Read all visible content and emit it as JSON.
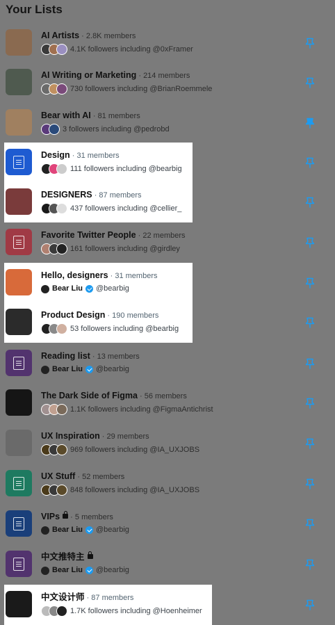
{
  "header": {
    "title": "Your Lists"
  },
  "lists": [
    {
      "name": "AI Artists",
      "members": "2.8K members",
      "sub": "4.1K followers including @0xFramer",
      "pinned": false,
      "highlight": false,
      "thumb": "#8a6a50",
      "avatars": [
        "#3a3a3a",
        "#a07050",
        "#9a8fc0"
      ]
    },
    {
      "name": "AI Writing or Marketing",
      "members": "214 members",
      "sub": "730 followers including @BrianRoemmele",
      "pinned": false,
      "highlight": false,
      "thumb": "#4f5a4f",
      "avatars": [
        "#6a6a6a",
        "#c09060",
        "#7a4a7a"
      ]
    },
    {
      "name": "Bear with AI",
      "members": "81 members",
      "sub": "3 followers including @pedrobd",
      "pinned": true,
      "highlight": false,
      "thumb": "#a08060",
      "avatars": [
        "#5a3a7a",
        "#2a4a7a"
      ]
    },
    {
      "name": "Design",
      "members": "31 members",
      "sub": "111 followers including @bearbig",
      "pinned": false,
      "highlight": true,
      "thumb": "#1e5bd1",
      "avatars": [
        "#222222",
        "#e0457b",
        "#cccccc"
      ]
    },
    {
      "name": "DESIGNERS",
      "members": "87 members",
      "sub": "437 followers including @cellier_",
      "pinned": false,
      "highlight": true,
      "thumb": "#7a3b3b",
      "avatars": [
        "#1a1a1a",
        "#555555",
        "#dddddd"
      ]
    },
    {
      "name": "Favorite Twitter People",
      "members": "22 members",
      "sub": "161 followers including @girdley",
      "pinned": false,
      "highlight": false,
      "thumb": "#a03a45",
      "avatars": [
        "#b08070",
        "#3a3a3a",
        "#222222"
      ]
    },
    {
      "name": "Hello, designers",
      "members": "31 members",
      "sub": "@bearbig",
      "owner": "Bear Liu",
      "pinned": false,
      "highlight": true,
      "thumb": "#d86a3a",
      "avatars": []
    },
    {
      "name": "Product Design",
      "members": "190 members",
      "sub": "53 followers including @bearbig",
      "pinned": false,
      "highlight": true,
      "thumb": "#2b2b2b",
      "avatars": [
        "#222222",
        "#8a8a8a",
        "#d0b0a0"
      ]
    },
    {
      "name": "Reading list",
      "members": "13 members",
      "sub": "@bearbig",
      "owner": "Bear Liu",
      "pinned": false,
      "highlight": false,
      "thumb": "#52336e",
      "avatars": []
    },
    {
      "name": "The Dark Side of Figma",
      "members": "56 members",
      "sub": "1.1K followers including @FigmaAntichrist",
      "pinned": false,
      "highlight": false,
      "thumb": "#151515",
      "avatars": [
        "#a09090",
        "#c0a090",
        "#7a6a5a"
      ]
    },
    {
      "name": "UX Inspiration",
      "members": "29 members",
      "sub": "969 followers including @IA_UXJOBS",
      "pinned": false,
      "highlight": false,
      "thumb": "#6a6a6a",
      "avatars": [
        "#4a3a1a",
        "#3a3a3a",
        "#5a4a2a"
      ]
    },
    {
      "name": "UX Stuff",
      "members": "52 members",
      "sub": "848 followers including @IA_UXJOBS",
      "pinned": false,
      "highlight": false,
      "thumb": "#1e7a60",
      "avatars": [
        "#4a3a1a",
        "#3a3a3a",
        "#5a4a2a"
      ]
    },
    {
      "name": "VIPs",
      "members": "5 members",
      "sub": "@bearbig",
      "owner": "Bear Liu",
      "locked": true,
      "pinned": false,
      "highlight": false,
      "thumb": "#1a3f7a",
      "avatars": []
    },
    {
      "name": "中文推特主",
      "members": "",
      "sub": "@bearbig",
      "owner": "Bear Liu",
      "locked": true,
      "pinned": false,
      "highlight": false,
      "thumb": "#52336e",
      "avatars": []
    },
    {
      "name": "中文设计师",
      "members": "87 members",
      "sub": "1.7K followers including @Hoenheimer",
      "pinned": false,
      "highlight": true,
      "thumb": "#1a1a1a",
      "avatars": [
        "#bbbbbb",
        "#888888",
        "#222222"
      ]
    }
  ],
  "colors": {
    "pin_blue": "#1d9bf0",
    "verified": "#1d9bf0"
  },
  "icons": {
    "pin": "pin-icon",
    "lock": "lock-icon",
    "verified": "verified-badge-icon",
    "list": "list-icon"
  }
}
